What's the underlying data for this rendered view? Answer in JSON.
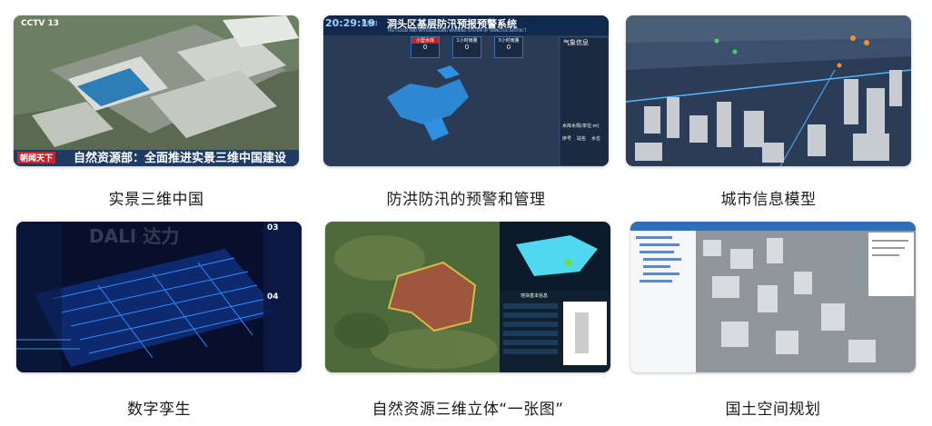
{
  "tiles": [
    {
      "caption": "实景三维中国",
      "overlay": {
        "channel_logo": "CCTV 13",
        "show_name": "朝闻天下",
        "headline": "自然资源部：全面推进实景三维中国建设"
      }
    },
    {
      "caption": "防洪防汛的预警和管理",
      "overlay": {
        "clock": "20:29:19",
        "weekday": "星期日",
        "system_title": "洞头区基层防汛预报预警系统",
        "subtitle": "THE FLOOD AND WATERLOGGING WARNING SYSTEM OF DONGTOU DISTRICT",
        "panel_title": "气象信息",
        "panel_row_1": "水库水情(单位:m)",
        "panel_cols": [
          "序号",
          "站名",
          "水位"
        ],
        "cards": [
          {
            "label": "小型水库",
            "value": "0"
          },
          {
            "label": "1小时雨量",
            "value": "0"
          },
          {
            "label": "3小时雨量",
            "value": "0"
          }
        ]
      }
    },
    {
      "caption": "城市信息模型",
      "overlay": {}
    },
    {
      "caption": "数字孪生",
      "overlay": {
        "watermark": "DALI 达力",
        "badge_1": "03",
        "badge_2": "04"
      }
    },
    {
      "caption": "自然资源三维立体“一张图”",
      "overlay": {
        "inset_table_title": "地块基本信息"
      }
    },
    {
      "caption": "国土空间规划",
      "overlay": {}
    }
  ]
}
